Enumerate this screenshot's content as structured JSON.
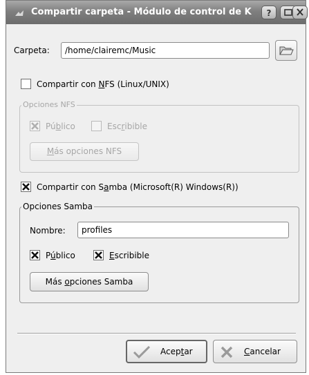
{
  "window": {
    "title": "Compartir carpeta - Módulo de control de K",
    "help_label": "?"
  },
  "folder": {
    "label": "Carpeta:",
    "value": "/home/clairemc/Music"
  },
  "nfs": {
    "share_pre": "Compartir con ",
    "share_key": "N",
    "share_post": "FS (Linux/UNIX)",
    "share_checked": false,
    "group_title": "Opciones NFS",
    "public_pre": "Pú",
    "public_key": "b",
    "public_post": "lico",
    "public_checked": true,
    "writable_pre": "Esc",
    "writable_key": "r",
    "writable_post": "ibible",
    "writable_checked": false,
    "more_pre": "",
    "more_key": "M",
    "more_post": "ás opciones NFS"
  },
  "samba": {
    "share_pre": "Compartir con S",
    "share_key": "a",
    "share_post": "mba (Microsoft(R) Windows(R))",
    "share_checked": true,
    "group_title": "Opciones Samba",
    "name_label": "Nombre:",
    "name_value": "profiles",
    "public_pre": "P",
    "public_key": "ú",
    "public_post": "blico",
    "public_checked": true,
    "writable_pre": "",
    "writable_key": "E",
    "writable_post": "scribible",
    "writable_checked": true,
    "more_pre": "Más ",
    "more_key": "o",
    "more_post": "pciones Samba"
  },
  "buttons": {
    "ok_pre": "Acep",
    "ok_key": "t",
    "ok_post": "ar",
    "cancel_pre": "",
    "cancel_key": "C",
    "cancel_post": "ancelar"
  },
  "icons": {
    "title": "app-icon",
    "browse": "folder-open-icon",
    "check": "x-check-icon",
    "ok": "checkmark-icon",
    "cancel": "x-cancel-icon"
  }
}
